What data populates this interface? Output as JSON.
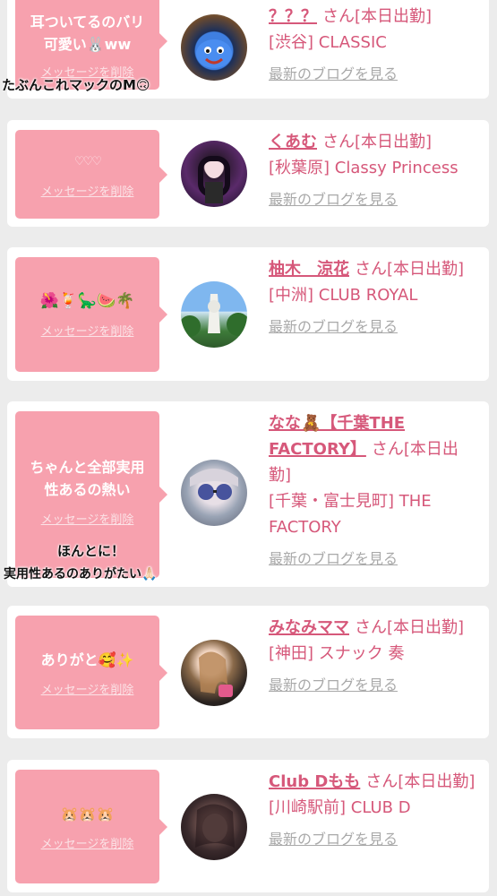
{
  "delete_label": "メッセージを削除",
  "san_label": "さん[本日出勤]",
  "blog_label": "最新のブログを見る",
  "overlays": {
    "first": "たぶんこれマックのM🙃",
    "fourth_line1": "ほんとに！",
    "fourth_line2": "実用性あるのありがたい🙏🏻"
  },
  "cards": [
    {
      "message": "耳ついてるのバリ可愛い🐰ww",
      "name": "？？？",
      "shop": "[渋谷] CLASSIC"
    },
    {
      "message": "♡♡♡",
      "name": "くあむ",
      "shop": "[秋葉原] Classy Princess"
    },
    {
      "message": "🌺🍹🦕🍉🌴",
      "name": "柚木　涼花",
      "shop": "[中洲] CLUB ROYAL"
    },
    {
      "message": "ちゃんと全部実用性あるの熱い",
      "name": "なな🧸【千葉THE FACTORY】",
      "shop": "[千葉・富士見町] THE FACTORY"
    },
    {
      "message": "ありがと🥰✨",
      "name": "みなみママ",
      "shop": "[神田] スナック 奏"
    },
    {
      "message": "🐹🐹🐹",
      "name": "Club Dもも",
      "shop": "[川崎駅前] CLUB D"
    }
  ],
  "colors": {
    "bubble": "#f7a1ae",
    "name": "#d6587a",
    "blog_link": "#a9a9a9",
    "background": "#ececec"
  }
}
